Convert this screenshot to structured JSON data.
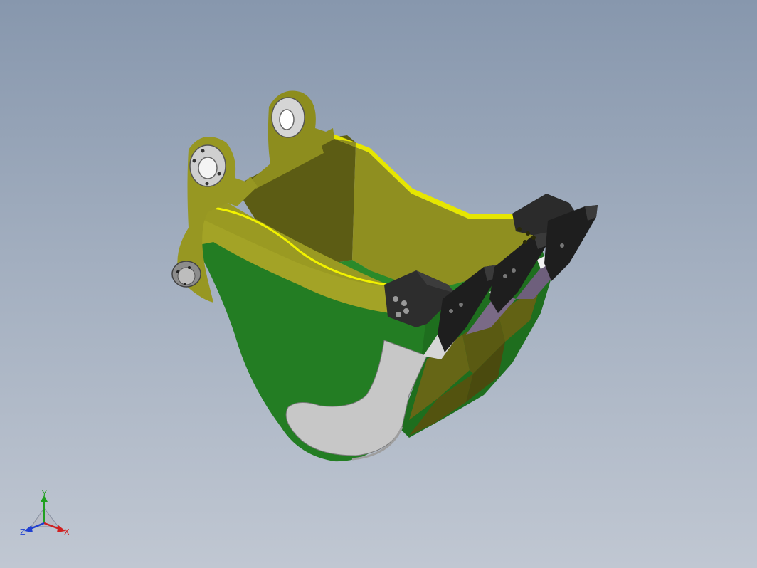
{
  "view": {
    "background_top": "#8797ad",
    "background_bottom": "#c0c7d2"
  },
  "model": {
    "colors": {
      "side_plate": "#9a9a22",
      "side_plate_dark": "#6f6f18",
      "body_green": "#1f7a1f",
      "body_green_light": "#2f962f",
      "edge_yellow": "#f0f000",
      "inner_dark": "#4a4a10",
      "wear_plate": "#c4c4c4",
      "teeth": "#262626",
      "bushing": "#8c8c8c"
    }
  },
  "triad": {
    "labels": {
      "x": "X",
      "y": "Y",
      "z": "Z"
    },
    "colors": {
      "x": "#d02020",
      "y": "#20a020",
      "z": "#2040d0"
    }
  }
}
